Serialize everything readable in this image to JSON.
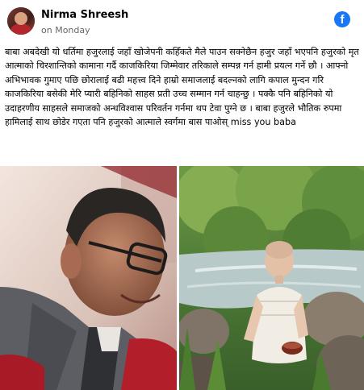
{
  "post": {
    "author": "Nirma Shreesh",
    "time": "on Monday",
    "platform_icon": "facebook-icon",
    "text": "बाबा अबदेखी यो धर्तिमा हजुरलाई जहाँ खोजेपनी कहिँकते मैले पाउन सक्नेछैन हजुर जहाँ भएपनि हजुरको मृत आत्माको चिरशान्तिको कामाना गर्दै काजकिरिया जिम्मेवार तरिकाले सम्पन्न गर्न हामी प्रयत्न गर्ने छौ । आफ्नो अभिभावक गुमाए पछि छोरालाई बढी महत्त्व दिने हाम्रो समाजलाई बदल्नको लागि कपाल मुन्दन गरि काजकिरिया बसेकी मेरि प्यारी बहिनिको साहस प्रती उच्च सम्मान गर्न चाहन्छु । पक्कै पनि बहिनिको यो उदाहरणीय साहसले समाजको अन्धविश्वास परिवर्तन गर्नमा थप टेवा पुग्ने छ । बाबा हजुरले भौतिक रुपमा हामिलाई साथ छोडेर गएता पनि हजुरको आत्माले स्वर्गमा बास पाओस् miss you baba"
  },
  "colors": {
    "facebook_blue": "#1877f2",
    "secondary_text": "#65676b"
  }
}
